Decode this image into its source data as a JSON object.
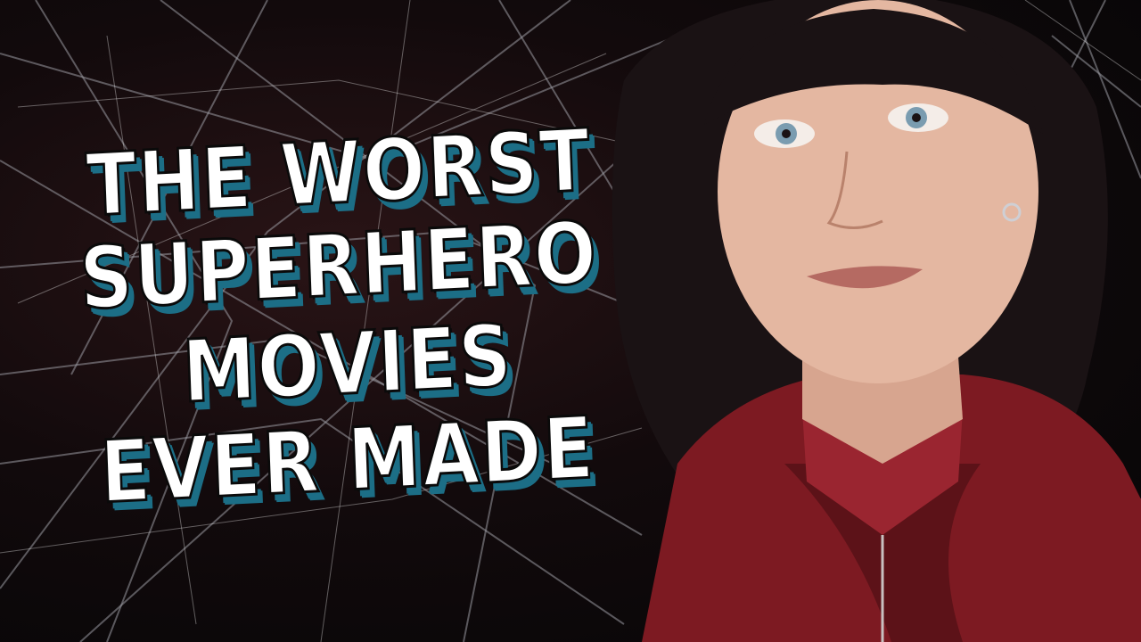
{
  "headline": {
    "line1": "THE WORST",
    "line2": "SUPERHERO",
    "line3": "MOVIES",
    "line4": "EVER MADE"
  },
  "colors": {
    "text": "#ffffff",
    "shadow": "#1c6e86",
    "jacket": "#8a1c24",
    "hair": "#1a1214"
  },
  "image": {
    "subject": "portrait-woman-red-jacket",
    "background": "spider-web-lines"
  }
}
